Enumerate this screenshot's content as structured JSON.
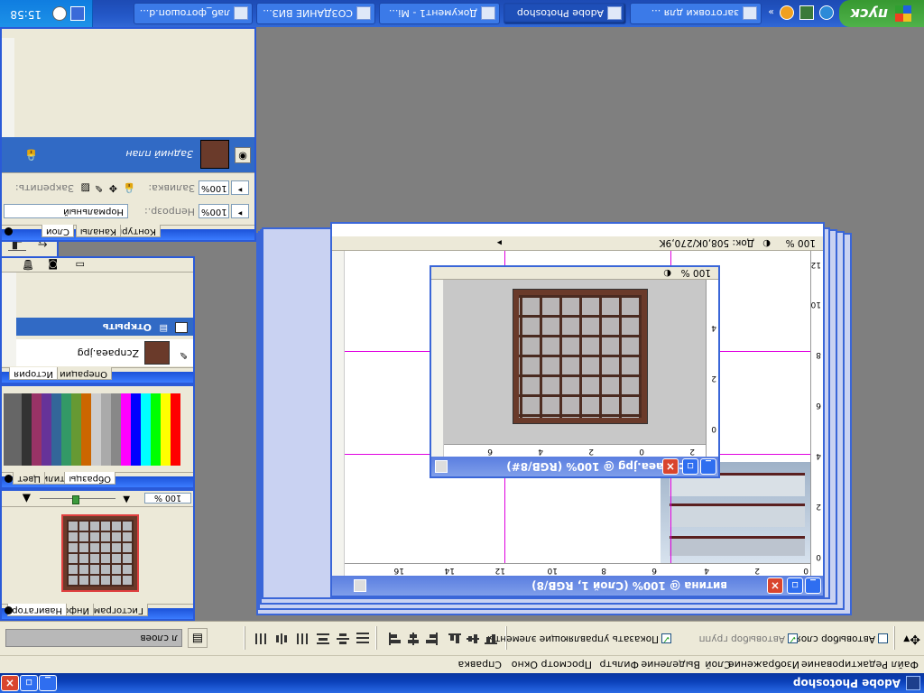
{
  "app": {
    "title": "Adobe Photoshop"
  },
  "menu": [
    "Файл",
    "Редактирование",
    "Изображение",
    "Слой",
    "Выделение",
    "Фильтр",
    "Просмотр",
    "Окно",
    "Справка"
  ],
  "options": {
    "autoselect_layer": "Автовыбор слоя",
    "autoselect_groups": "Автовыбор групп",
    "show_transform": "Показать управляющие элементы",
    "right_field": "л слоев"
  },
  "navigator": {
    "tabs": [
      "Навигатор",
      "Инфо",
      "Гистограмма"
    ],
    "zoom": "100 %"
  },
  "swatches": {
    "tabs": [
      "Цвет",
      "Образцы",
      "Стили"
    ]
  },
  "history": {
    "tabs": [
      "История",
      "Операции"
    ],
    "snapshot": "Zcnpaea.jpg",
    "open_step": "Открыть"
  },
  "layers": {
    "tabs": [
      "Слои",
      "Каналы",
      "Контуры"
    ],
    "blend_mode": "Нормальный",
    "opacity_label": "Непрозр.:",
    "opacity": "100%",
    "lock_label": "Закрепить:",
    "fill_label": "Заливка:",
    "fill": "100%",
    "layer_name": "Задний план"
  },
  "doc_main": {
    "title": "витина @ 100% (Слой 1, RGB/8)",
    "zoom": "100 %",
    "doc_size": "Док: 508,0K/270,9K",
    "ruler_top": [
      "0",
      "2",
      "4",
      "6",
      "8",
      "10",
      "12",
      "14",
      "16"
    ],
    "ruler_left": [
      "0",
      "2",
      "4",
      "6",
      "8",
      "10",
      "12"
    ]
  },
  "doc_small": {
    "title": "Zcnpaea.jpg @ 100% (RGB/8#)",
    "zoom": "100 %",
    "ruler_top": [
      "2",
      "0",
      "2",
      "4",
      "6"
    ],
    "ruler_left": [
      "0",
      "2",
      "4"
    ]
  },
  "taskbar": {
    "start": "пуск",
    "buttons": [
      "заготовки для ...",
      "Adobe Photoshop",
      "Документ1 - Mi...",
      "СОЗДАНИЕ ВИЗ...",
      "лаб_фотошоп.d..."
    ],
    "clock": "15:58"
  },
  "colors": {
    "accent": "#2a5ad8",
    "background_swatch": "#f8a0c8",
    "foreground_swatch": "#ffffff"
  }
}
